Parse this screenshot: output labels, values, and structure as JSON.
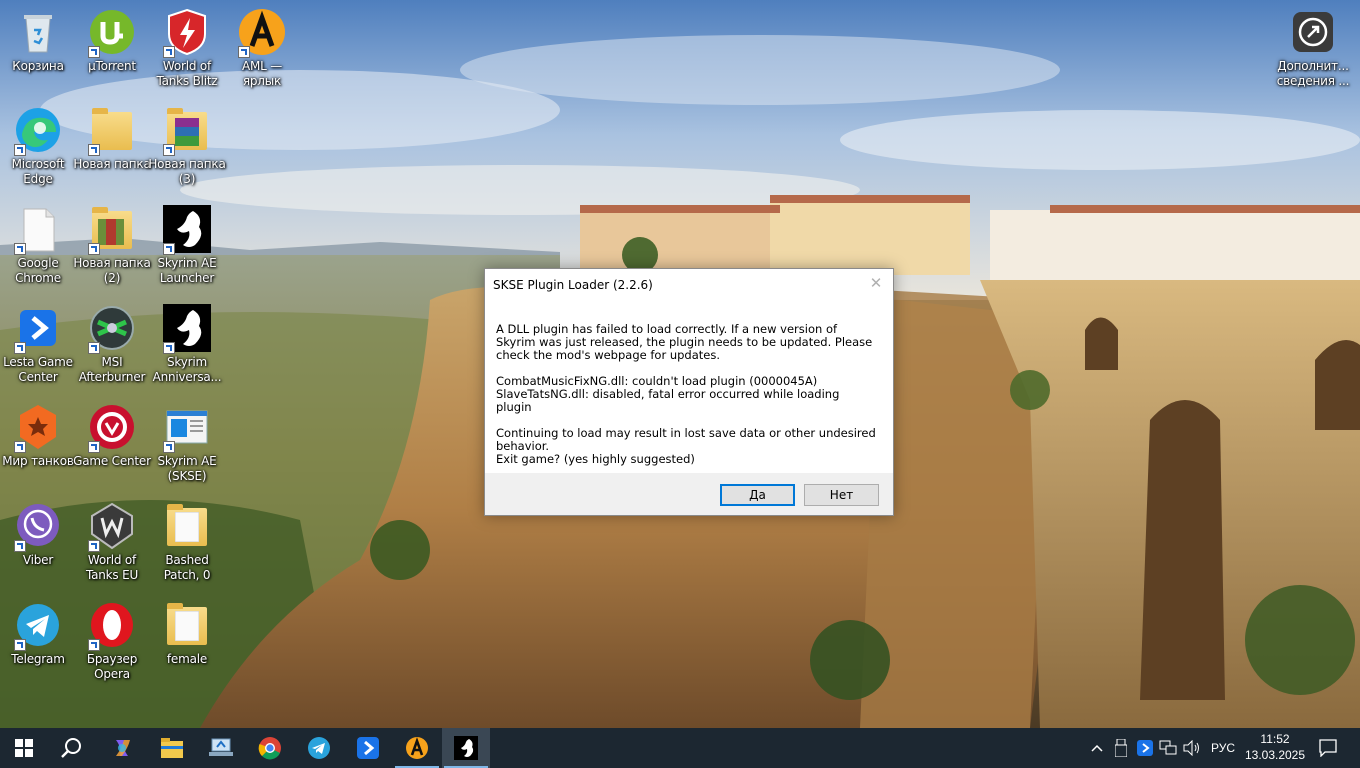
{
  "desktop": {
    "icons": [
      {
        "label": "Корзина"
      },
      {
        "label": "µTorrent"
      },
      {
        "label": "World of Tanks Blitz"
      },
      {
        "label": "AML — ярлык"
      },
      {
        "label": "Microsoft Edge"
      },
      {
        "label": "Новая папка"
      },
      {
        "label": "Новая папка (3)"
      },
      {
        "label": "Google Chrome"
      },
      {
        "label": "Новая папка (2)"
      },
      {
        "label": "Skyrim AE Launcher"
      },
      {
        "label": "Lesta Game Center"
      },
      {
        "label": "MSI Afterburner"
      },
      {
        "label": "Skyrim Anniversa..."
      },
      {
        "label": "Мир танков"
      },
      {
        "label": "Game Center"
      },
      {
        "label": "Skyrim AE (SKSE)"
      },
      {
        "label": "Viber"
      },
      {
        "label": "World of Tanks EU"
      },
      {
        "label": "Bashed Patch, 0"
      },
      {
        "label": "Telegram"
      },
      {
        "label": "Браузер Opera"
      },
      {
        "label": "female"
      },
      {
        "label": "Дополнит... сведения ..."
      }
    ]
  },
  "dialog": {
    "title": "SKSE Plugin Loader (2.2.6)",
    "message_1": "A DLL plugin has failed to load correctly. If a new version of Skyrim was just released, the plugin needs to be updated. Please check the mod's webpage for updates.",
    "error_line_1": "CombatMusicFixNG.dll: couldn't load plugin (0000045A)",
    "error_line_2": "SlaveTatsNG.dll: disabled, fatal error occurred while loading plugin",
    "warning": "Continuing to load may result in lost save data or other undesired behavior.",
    "question": "Exit game? (yes highly suggested)",
    "yes_label": "Да",
    "no_label": "Нет",
    "close_glyph": "✕"
  },
  "taskbar": {
    "language": "РУС",
    "time": "11:52",
    "date": "13.03.2025",
    "apps": [
      "start-icon",
      "search-icon",
      "copilot-icon",
      "file-explorer-icon",
      "remote-desktop-icon",
      "chrome-icon",
      "telegram-icon",
      "lesta-icon",
      "aml-icon",
      "skyrim-icon"
    ]
  },
  "colors": {
    "taskbar_bg": "#1c2731",
    "accent": "#0078d7",
    "dialog_footer": "#f0f0f0"
  }
}
